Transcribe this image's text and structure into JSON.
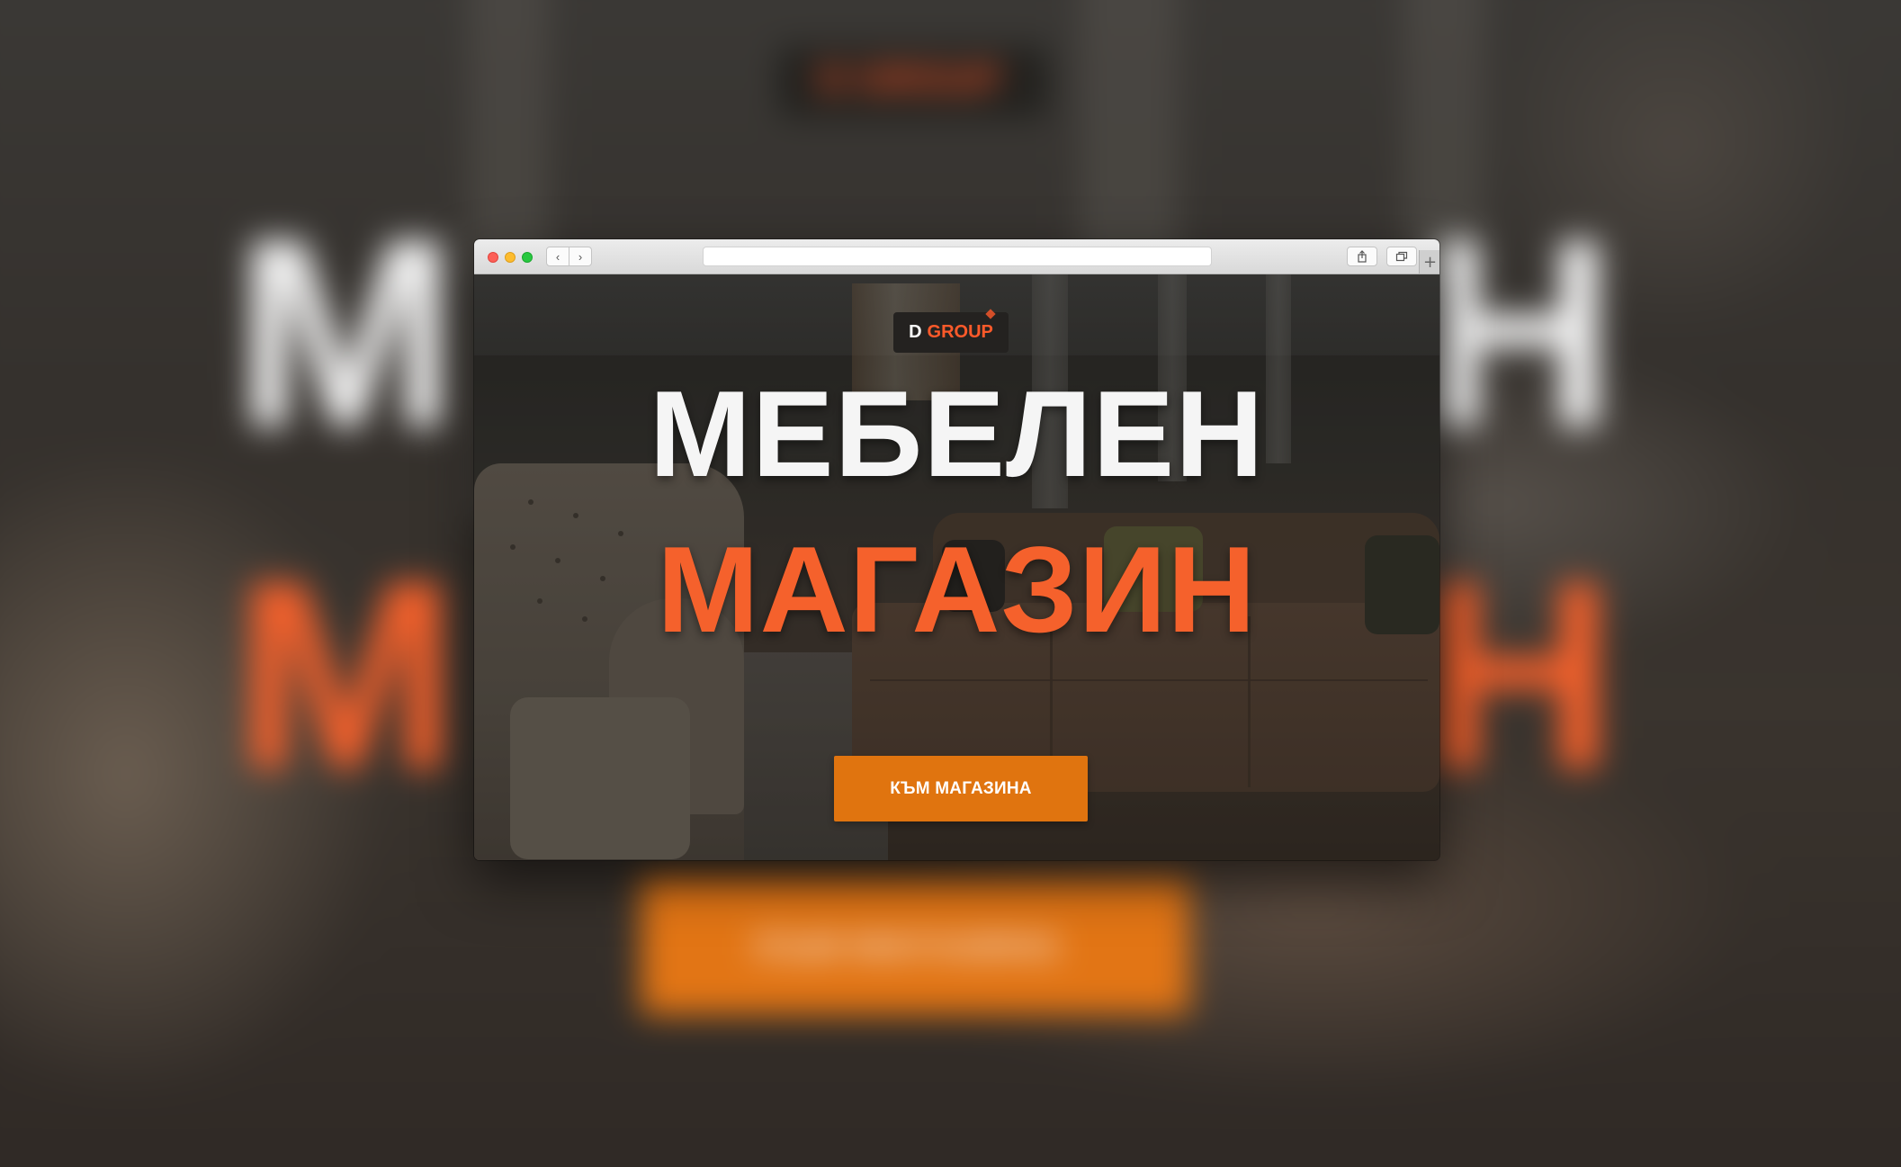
{
  "background": {
    "logo_text": "D GROUP",
    "headline_left_1": "М",
    "headline_right_1": "Н",
    "headline_left_2": "М",
    "headline_right_2": "Н",
    "button_text": "КЪМ МАГАЗИНА"
  },
  "browser": {
    "url": "",
    "back_glyph": "‹",
    "forward_glyph": "›",
    "new_tab_glyph": "+",
    "icons": [
      "close-icon",
      "minimize-icon",
      "zoom-icon",
      "chevron-left-icon",
      "chevron-right-icon",
      "share-icon",
      "tabs-icon",
      "plus-icon"
    ]
  },
  "page": {
    "logo": {
      "d": "D",
      "group": "GROUP"
    },
    "headline_line1": "МЕБЕЛЕН",
    "headline_line2": "МАГАЗИН",
    "cta_label": "КЪМ МАГАЗИНА"
  },
  "colors": {
    "accent_orange": "#f5612c",
    "button_orange": "#e0740f",
    "headline_white": "#f5f5f5",
    "logo_bg": "#242220"
  }
}
